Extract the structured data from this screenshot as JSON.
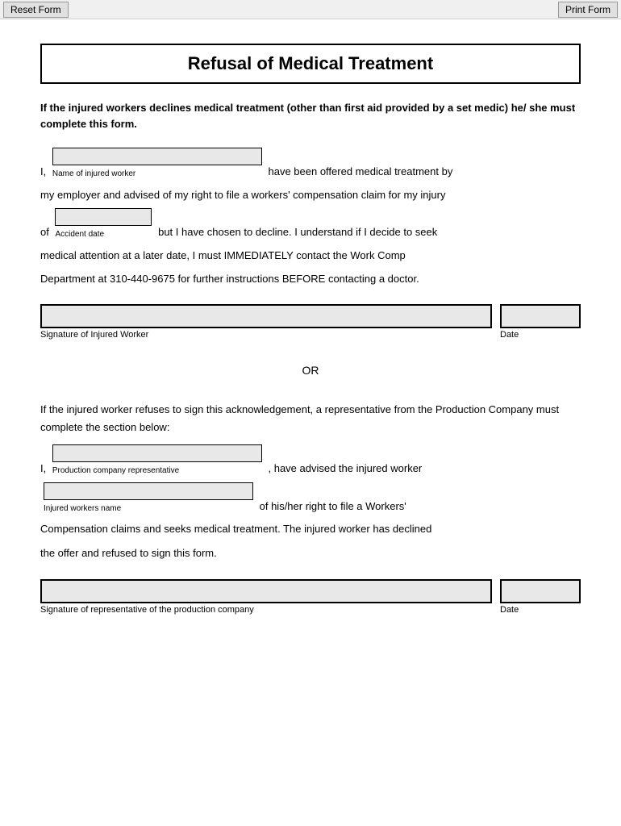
{
  "toolbar": {
    "reset_label": "Reset Form",
    "print_label": "Print Form"
  },
  "form": {
    "title": "Refusal of Medical Treatment",
    "intro": "If the injured workers declines medical treatment (other than first aid provided by a set medic) he/ she must complete this form.",
    "section1": {
      "line1_prefix": "I,",
      "line1_suffix": "have been offered medical treatment by",
      "line2": "my employer and advised of my right to file a workers' compensation claim for my injury",
      "line3_prefix": "of",
      "line3_suffix": "but I have chosen to decline.  I understand if I decide to seek",
      "line4": "medical attention at a later date, I must IMMEDIATELY contact the Work Comp",
      "line5": "Department at 310-440-9675 for further instructions BEFORE contacting a doctor.",
      "name_label": "Name of injured worker",
      "accident_date_label": "Accident date",
      "sig_label": "Signature of Injured Worker",
      "date_label": "Date"
    },
    "or_text": "OR",
    "section2": {
      "refusal_text": "If the injured worker refuses to sign this acknowledgement, a representative from the Production Company must complete the section below:",
      "line1_prefix": "I,",
      "line1_suffix": ", have advised the injured worker",
      "rep_label": "Production company representative",
      "line2_suffix": "of his/her right to file a Workers'",
      "injured_label": "Injured workers name",
      "line3": "Compensation claims and seeks medical treatment.  The injured worker has declined",
      "line4": "the offer and refused to sign this form.",
      "sig_label": "Signature of representative of the production company",
      "date_label": "Date"
    }
  }
}
